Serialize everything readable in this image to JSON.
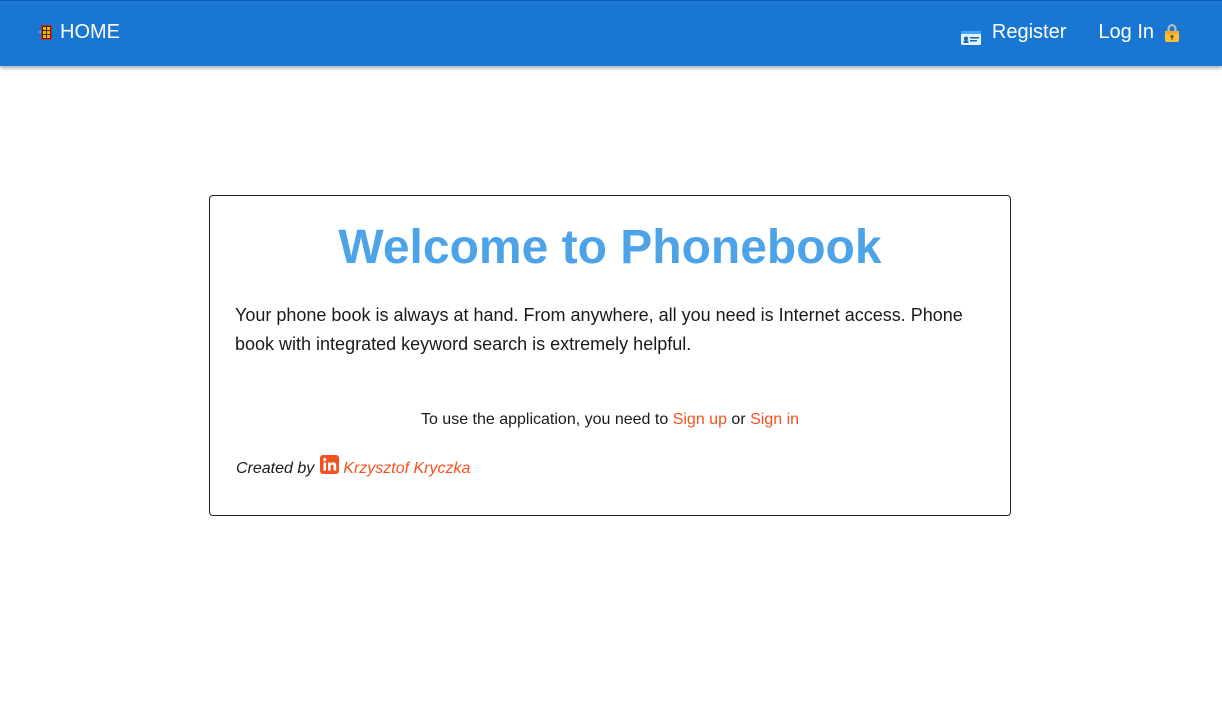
{
  "header": {
    "home_label": "HOME",
    "register_label": "Register",
    "login_label": "Log In",
    "icons": {
      "home": "door-icon",
      "register": "id-card-icon",
      "login": "lock-icon"
    },
    "background_color": "#1976d2"
  },
  "main": {
    "title": "Welcome to Phonebook",
    "description": "Your phone book is always at hand. From anywhere, all you need is Internet access. Phone book with integrated keyword search is extremely helpful.",
    "cta_prefix": "To use the application, you need to",
    "signup_label": "Sign up",
    "cta_or": "or",
    "signin_label": "Sign in",
    "credit_prefix": "Created by",
    "author_name": "Krzysztof Kryczka",
    "author_icon": "linkedin-icon",
    "title_color": "#4ca3e8",
    "link_color": "#f4511e"
  }
}
